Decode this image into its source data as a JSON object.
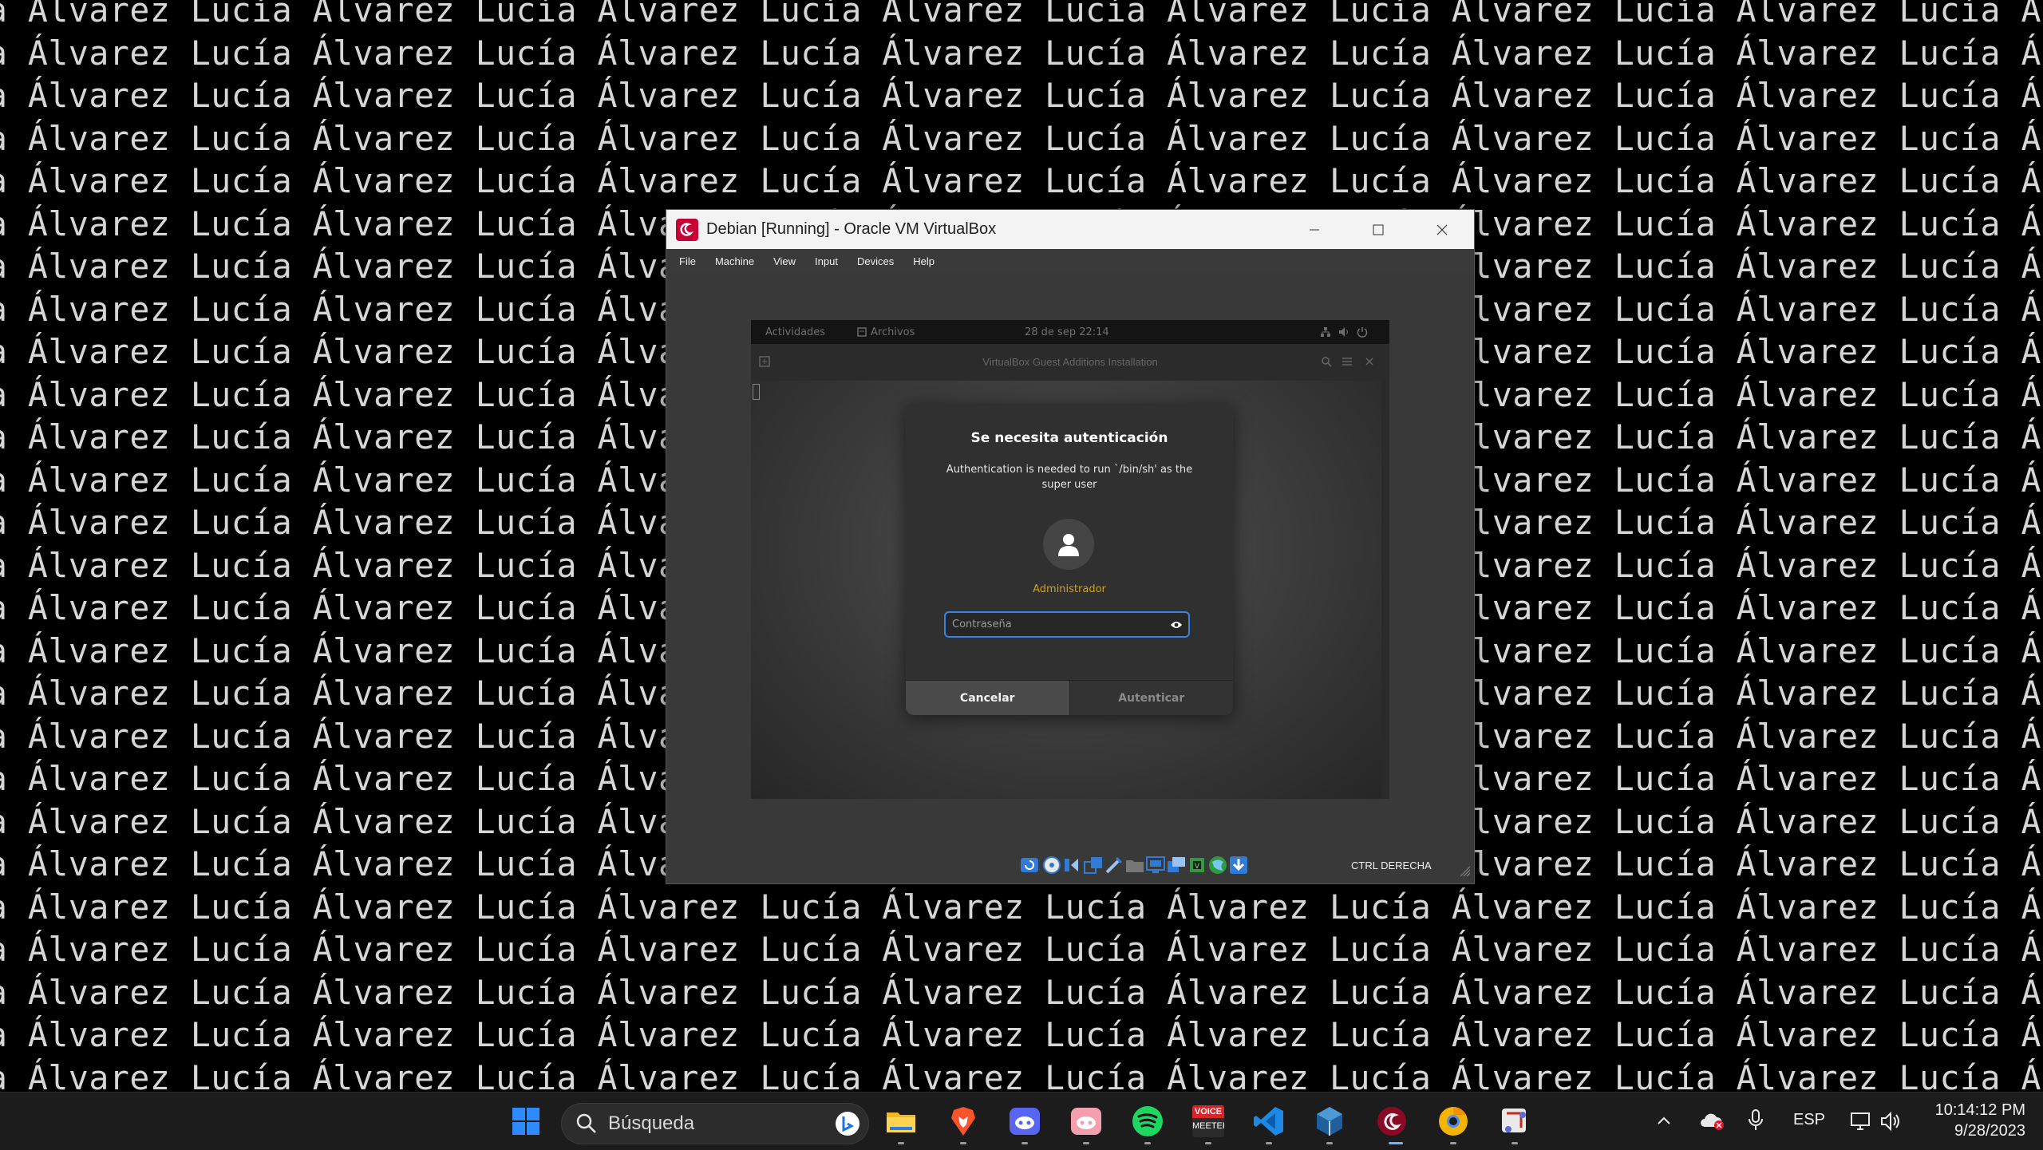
{
  "wallpaper": {
    "text": "Lucía Álvarez"
  },
  "vbox": {
    "title": "Debian [Running] - Oracle VM VirtualBox",
    "menu": [
      "File",
      "Machine",
      "View",
      "Input",
      "Devices",
      "Help"
    ],
    "host_key": "CTRL DERECHA"
  },
  "guest": {
    "topbar": {
      "activities": "Actividades",
      "app": "Archivos",
      "clock": "28 de sep  22:14"
    },
    "files_title": "VirtualBox Guest Additions Installation",
    "dialog": {
      "title": "Se necesita autenticación",
      "message": "Authentication is needed to run `/bin/sh' as the super user",
      "user": "Administrador",
      "password_placeholder": "Contraseña",
      "cancel": "Cancelar",
      "authenticate": "Autenticar"
    }
  },
  "taskbar": {
    "search_placeholder": "Búsqueda",
    "language": "ESP",
    "time": "10:14:12 PM",
    "date": "9/28/2023",
    "apps": [
      "windows-start",
      "file-explorer",
      "brave",
      "discord-ptb",
      "discord",
      "spotify",
      "voicemeeter",
      "vscode",
      "virtualbox",
      "debian",
      "chrome-canary",
      "snipping-tool"
    ],
    "voicemeeter_label_top": "VOICE",
    "voicemeeter_label_bottom": "MEETER"
  },
  "colors": {
    "accent_blue": "#3584e4",
    "user_name_color": "#d4a017",
    "taskbar_bg": "#1c1c1c"
  }
}
